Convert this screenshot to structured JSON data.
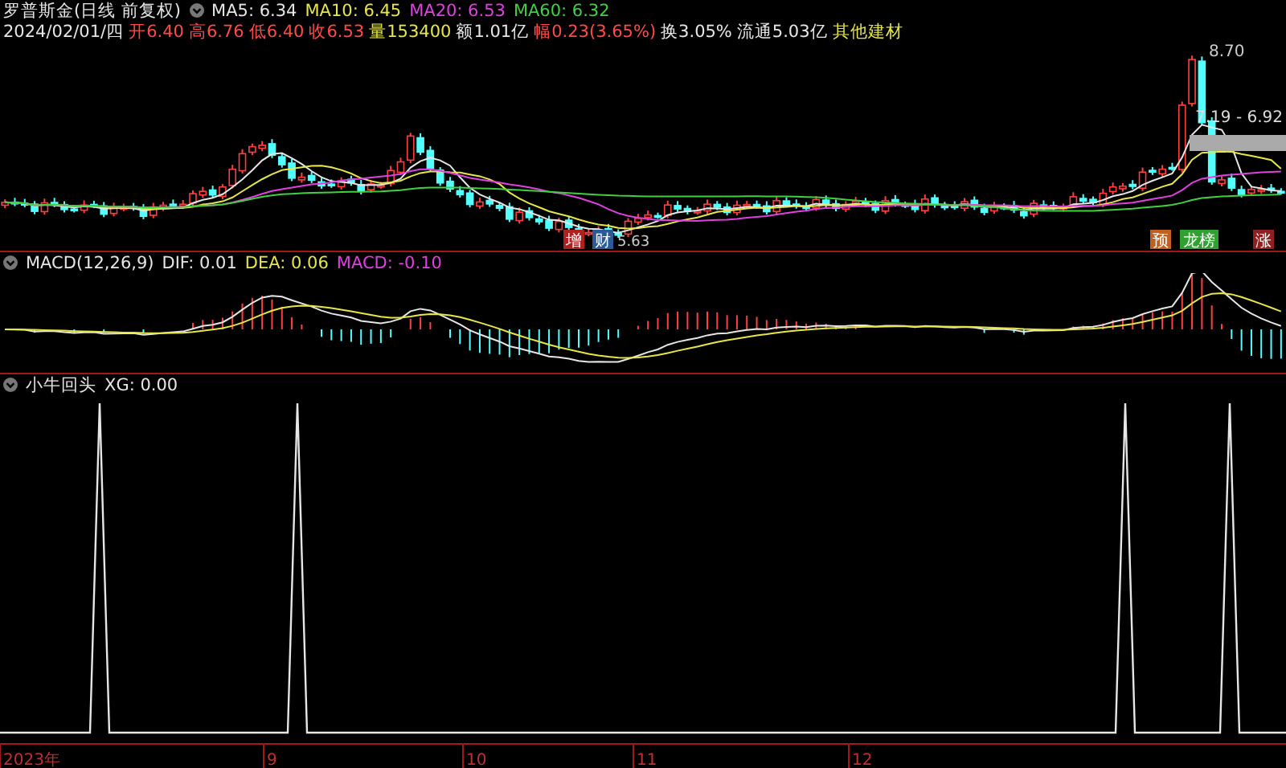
{
  "header": {
    "title": "罗普斯金(日线 前复权)",
    "indicators": [
      {
        "label": "MA5: 6.34",
        "color": "#e6e6e6"
      },
      {
        "label": "MA10: 6.45",
        "color": "#e6e64a"
      },
      {
        "label": "MA20: 6.53",
        "color": "#e040e0"
      },
      {
        "label": "MA60: 6.32",
        "color": "#40d040"
      }
    ]
  },
  "quote": [
    {
      "text": "2024/02/01/四",
      "color": "#e6e6e6"
    },
    {
      "text": "开6.40",
      "color": "#ff4a4a"
    },
    {
      "text": "高6.76",
      "color": "#ff4a4a"
    },
    {
      "text": "低6.40",
      "color": "#ff4a4a"
    },
    {
      "text": "收6.53",
      "color": "#ff4a4a"
    },
    {
      "text": "量153400",
      "color": "#e6e64a"
    },
    {
      "text": "额1.01亿",
      "color": "#e6e6e6"
    },
    {
      "text": "幅0.23(3.65%)",
      "color": "#ff4a4a"
    },
    {
      "text": "换3.05%",
      "color": "#e6e6e6"
    },
    {
      "text": "流通5.03亿",
      "color": "#e6e6e6"
    },
    {
      "text": "其他建材",
      "color": "#e6e64a"
    }
  ],
  "price_panel": {
    "high_label": "8.70",
    "low_label": "5.63",
    "range_label": "7.19 - 6.92",
    "events": [
      {
        "text": "增",
        "color": "#b02020"
      },
      {
        "text": "财",
        "color": "#2a5a9a"
      },
      {
        "text": "预",
        "color": "#c06020"
      },
      {
        "text": "龙榜",
        "color": "#30a030"
      },
      {
        "text": "涨",
        "color": "#902020"
      }
    ]
  },
  "macd_panel": {
    "title": "MACD(12,26,9)",
    "values": [
      {
        "label": "DIF: 0.01",
        "color": "#e6e6e6"
      },
      {
        "label": "DEA: 0.06",
        "color": "#e6e64a"
      },
      {
        "label": "MACD: -0.10",
        "color": "#e040e0"
      }
    ]
  },
  "signal_panel": {
    "title": "小牛回头",
    "value": "XG: 0.00"
  },
  "time_axis": [
    "2023年",
    "9",
    "10",
    "11",
    "12"
  ]
}
